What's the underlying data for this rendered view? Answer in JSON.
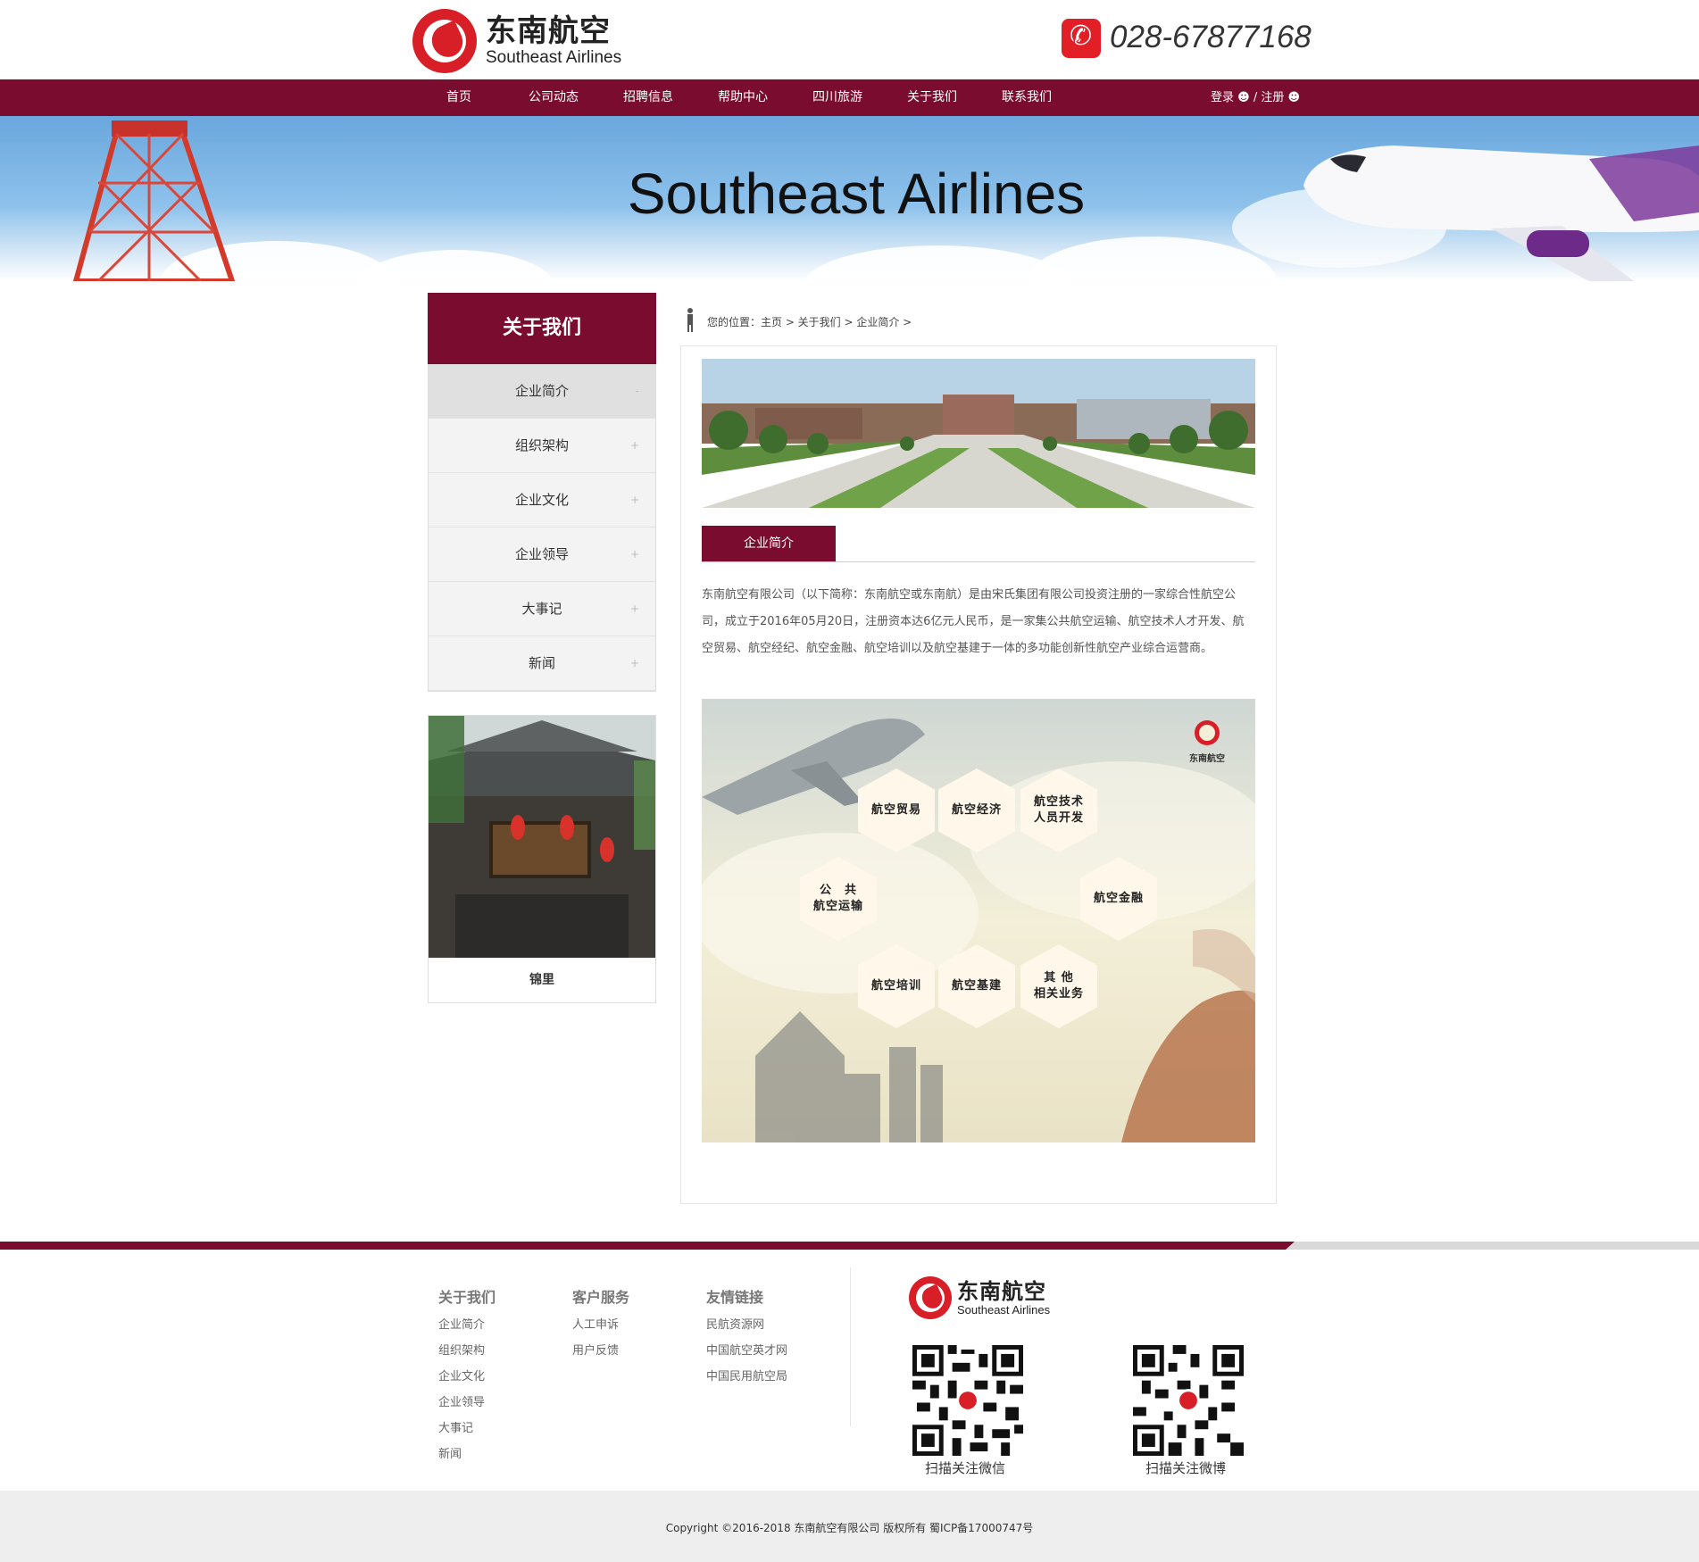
{
  "brand": {
    "name_cn": "东南航空",
    "name_en": "Southeast Airlines"
  },
  "header": {
    "phone": "028-67877168"
  },
  "nav": {
    "items": [
      "首页",
      "公司动态",
      "招聘信息",
      "帮助中心",
      "四川旅游",
      "关于我们",
      "联系我们"
    ],
    "login": "登录",
    "separator": "/",
    "register": "注册"
  },
  "banner": {
    "title": "Southeast Airlines"
  },
  "sidebar": {
    "title": "关于我们",
    "items": [
      {
        "label": "企业简介",
        "mark": "-"
      },
      {
        "label": "组织架构",
        "mark": "+"
      },
      {
        "label": "企业文化",
        "mark": "+"
      },
      {
        "label": "企业领导",
        "mark": "+"
      },
      {
        "label": "大事记",
        "mark": "+"
      },
      {
        "label": "新闻",
        "mark": "+"
      }
    ],
    "card_caption": "锦里"
  },
  "breadcrumb": "您的位置：主页 > 关于我们 > 企业简介 >",
  "content": {
    "tab": "企业简介",
    "intro": "东南航空有限公司（以下简称：东南航空或东南航）是由宋氏集团有限公司投资注册的一家综合性航空公司，成立于2016年05月20日，注册资本达6亿元人民币，是一家集公共航空运输、航空技术人才开发、航空贸易、航空经纪、航空金融、航空培训以及航空基建于一体的多功能创新性航空产业综合运营商。",
    "diagram": {
      "hexes": [
        "航空贸易",
        "航空经济",
        "航空技术\n人员开发",
        "公　共\n航空运输",
        "航空金融",
        "航空培训",
        "航空基建",
        "其 他\n相关业务"
      ]
    }
  },
  "footer": {
    "columns": [
      {
        "title": "关于我们",
        "links": [
          "企业简介",
          "组织架构",
          "企业文化",
          "企业领导",
          "大事记",
          "新闻"
        ]
      },
      {
        "title": "客户服务",
        "links": [
          "人工申诉",
          "用户反馈"
        ]
      },
      {
        "title": "友情链接",
        "links": [
          "民航资源网",
          "中国航空英才网",
          "中国民用航空局"
        ]
      }
    ],
    "qr": [
      {
        "caption": "扫描关注微信"
      },
      {
        "caption": "扫描关注微博"
      }
    ],
    "copyright": "Copyright ©2016-2018 东南航空有限公司 版权所有 蜀ICP备17000747号"
  },
  "colors": {
    "primary": "#7a0d2f",
    "logo_red": "#d81e26"
  }
}
